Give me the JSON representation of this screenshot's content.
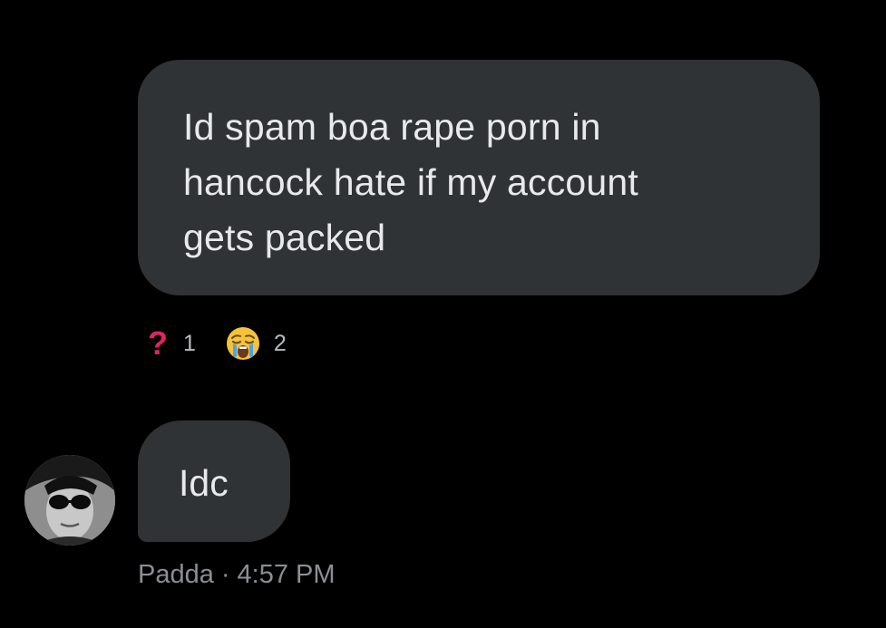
{
  "messages": [
    {
      "lines": [
        "Id spam boa rape porn in",
        "hancock  hate if my account",
        "gets packed"
      ],
      "reactions": [
        {
          "icon": "question-mark-icon",
          "glyph": "?",
          "count": "1",
          "color": "#e0245e"
        },
        {
          "icon": "crying-face-emoji",
          "count": "2"
        }
      ]
    },
    {
      "text": "Idc",
      "sender": "Padda",
      "separator": "·",
      "time": "4:57 PM"
    }
  ],
  "colors": {
    "background": "#000000",
    "bubble": "#2f3336",
    "text": "#e7e9ea",
    "meta": "#8b8f93",
    "reaction_count": "#b9bcc0",
    "question_accent": "#e0245e"
  }
}
